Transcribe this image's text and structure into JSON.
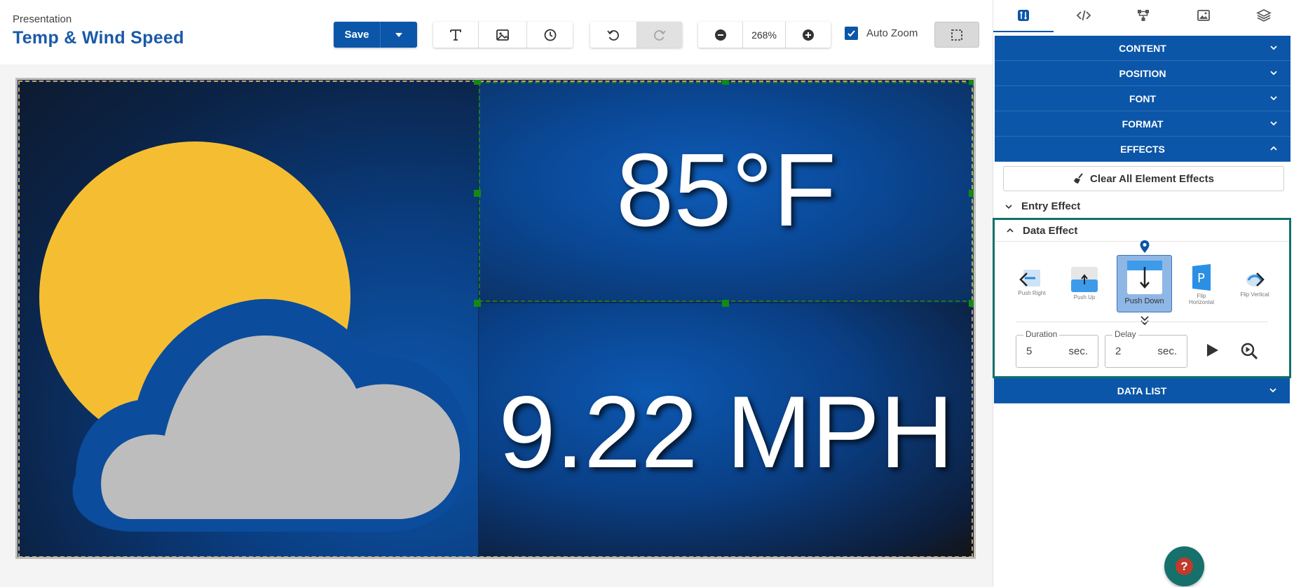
{
  "header": {
    "pre_title": "Presentation",
    "title": "Temp & Wind Speed"
  },
  "toolbar": {
    "save_label": "Save",
    "zoom_value": "268%",
    "auto_zoom_label": "Auto Zoom",
    "auto_zoom_checked": true
  },
  "canvas": {
    "temperature": "85°F",
    "wind_speed": "9.22 MPH",
    "colors": {
      "sun": "#F5BE32",
      "cloud": "#BDBDBD",
      "background": "#0B4A9A"
    }
  },
  "side_panel": {
    "sections": [
      {
        "label": "CONTENT",
        "expanded": false
      },
      {
        "label": "POSITION",
        "expanded": false
      },
      {
        "label": "FONT",
        "expanded": false
      },
      {
        "label": "FORMAT",
        "expanded": false
      },
      {
        "label": "EFFECTS",
        "expanded": true
      }
    ],
    "clear_effects_label": "Clear All Element Effects",
    "entry_effect_label": "Entry Effect",
    "data_effect_label": "Data Effect",
    "effects": [
      {
        "label": "Push Right",
        "selected": false
      },
      {
        "label": "Push Up",
        "selected": false
      },
      {
        "label": "Push Down",
        "selected": true
      },
      {
        "label": "Flip Horizontal",
        "selected": false
      },
      {
        "label": "Flip Vertical",
        "selected": false
      }
    ],
    "duration": {
      "label": "Duration",
      "value": "5",
      "unit": "sec."
    },
    "delay": {
      "label": "Delay",
      "value": "2",
      "unit": "sec."
    },
    "data_list_label": "DATA LIST"
  },
  "accent_color": "#0B56A8",
  "highlight_color": "#13706B"
}
